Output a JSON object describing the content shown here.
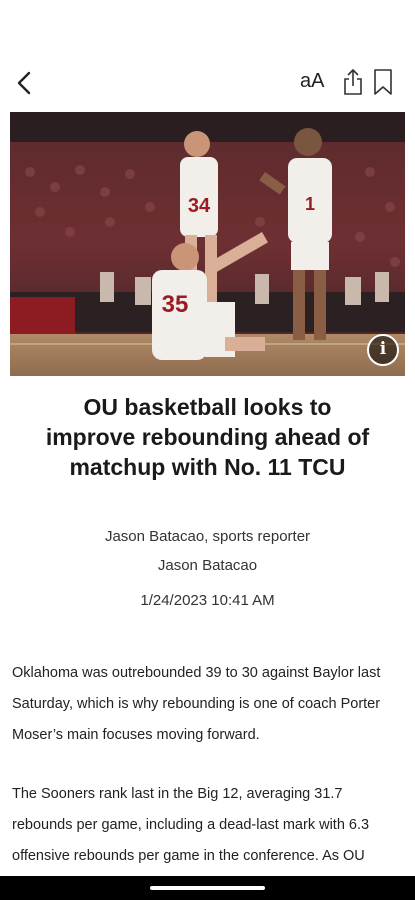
{
  "toolbar": {
    "back_icon": "chevron-left-icon",
    "text_size_label": "aA",
    "share_icon": "share-icon",
    "bookmark_icon": "bookmark-icon"
  },
  "photo": {
    "jersey_numbers": [
      "34",
      "1",
      "35"
    ],
    "info_label": "i"
  },
  "article": {
    "headline": "OU basketball looks to improve rebounding ahead of matchup with No. 11 TCU",
    "author_line": "Jason Batacao, sports reporter",
    "author_name": "Jason Batacao",
    "timestamp": "1/24/2023 10:41 AM",
    "paragraphs": [
      "Oklahoma was outrebounded 39 to 30 against Baylor last Saturday, which is why rebounding is one of coach Porter Moser’s main focuses moving forward.",
      "The Sooners rank last in the Big 12, averaging 31.7 rebounds per game, including a dead-last mark with 6.3 offensive rebounds per game in the conference. As OU"
    ]
  }
}
